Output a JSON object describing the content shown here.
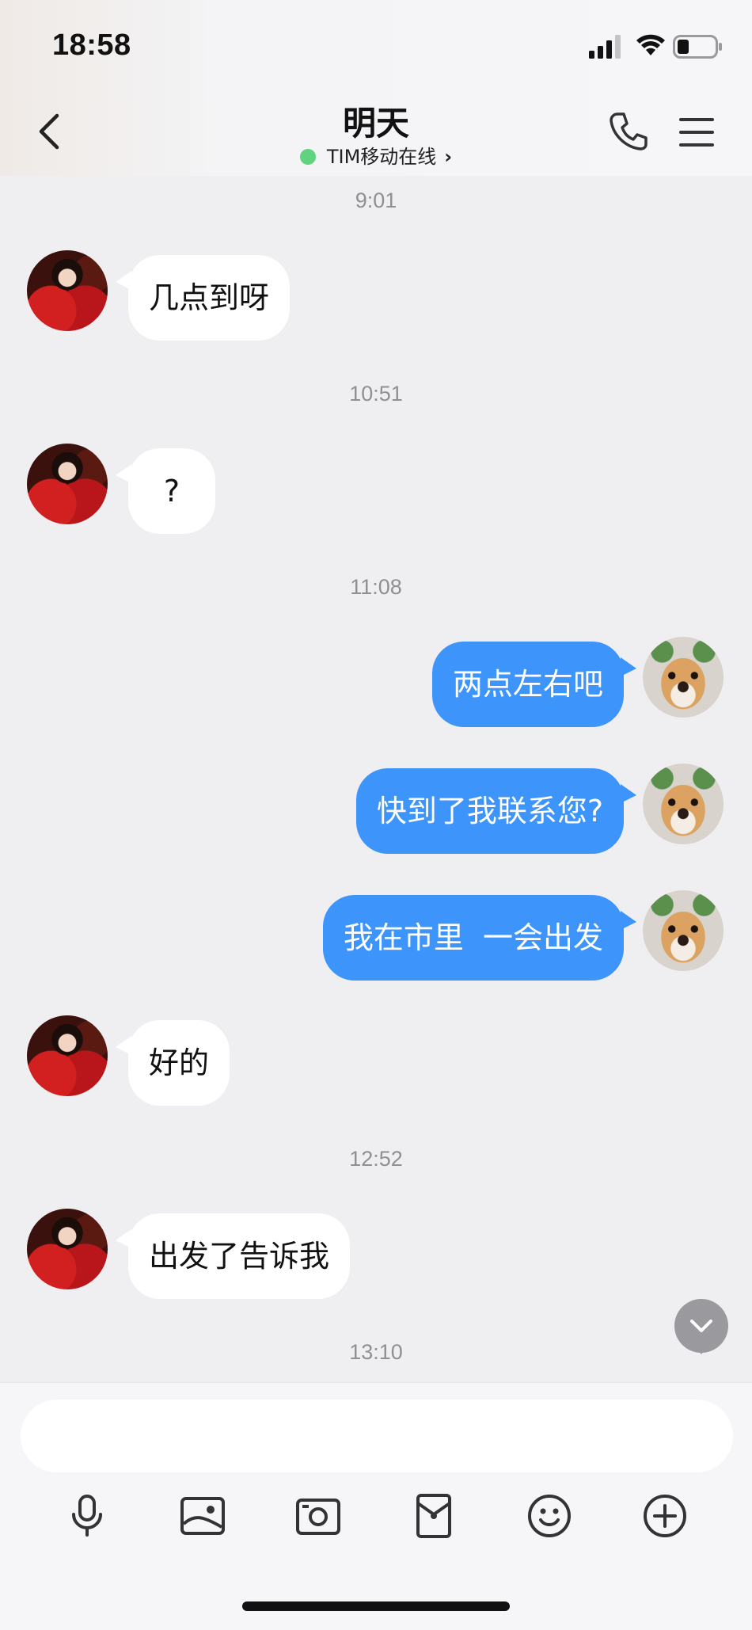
{
  "status_bar": {
    "time": "18:58"
  },
  "header": {
    "title": "明天",
    "subtitle": "TIM移动在线"
  },
  "messages": [
    {
      "timestamp": "9:01"
    },
    {
      "from": "other",
      "text": "几点到呀"
    },
    {
      "timestamp": "10:51"
    },
    {
      "from": "other",
      "text": "?"
    },
    {
      "timestamp": "11:08"
    },
    {
      "from": "me",
      "text": "两点左右吧"
    },
    {
      "from": "me",
      "text": "快到了我联系您?"
    },
    {
      "from": "me",
      "text": "我在市里  一会出发"
    },
    {
      "from": "other",
      "text": "好的"
    },
    {
      "timestamp": "12:52"
    },
    {
      "from": "other",
      "text": "出发了告诉我"
    },
    {
      "timestamp": "13:10"
    }
  ],
  "input": {
    "value": "",
    "placeholder": ""
  },
  "toolbar": [
    "mic-icon",
    "image-icon",
    "camera-icon",
    "red-packet-icon",
    "emoji-icon",
    "plus-icon"
  ],
  "colors": {
    "accent": "#3d94fb",
    "online": "#5fd37e",
    "background": "#efeff1"
  }
}
